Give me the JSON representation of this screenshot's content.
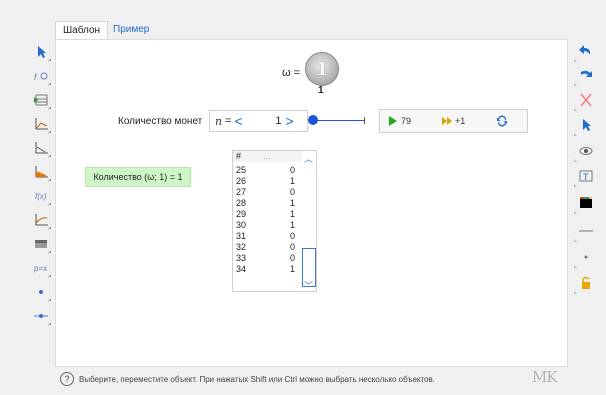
{
  "tabs": [
    {
      "label": "Шаблон"
    },
    {
      "label": "Пример"
    }
  ],
  "canvas": {
    "omega_label": "ω =",
    "coin_glyph": "1",
    "coin_value": "1",
    "count_label": "Количество монет",
    "stepper": {
      "var": "n",
      "eq": "=",
      "left": "<",
      "value": "1",
      "right": ">"
    },
    "slider": {
      "value": 1,
      "min": 1,
      "max": 10
    },
    "buttons": {
      "play_label": "79",
      "step_label": "+1"
    },
    "badge": "Количество (ω; 1) = 1",
    "table": {
      "headers": [
        "#",
        "..."
      ],
      "rows": [
        {
          "n": "25",
          "v": "0"
        },
        {
          "n": "26",
          "v": "1"
        },
        {
          "n": "27",
          "v": "0"
        },
        {
          "n": "28",
          "v": "1"
        },
        {
          "n": "29",
          "v": "1"
        },
        {
          "n": "30",
          "v": "1"
        },
        {
          "n": "31",
          "v": "0"
        },
        {
          "n": "32",
          "v": "0"
        },
        {
          "n": "33",
          "v": "0"
        },
        {
          "n": "34",
          "v": "1"
        }
      ]
    }
  },
  "status": {
    "text": "Выберите, переместите объект. При нажатых Shift или Ctrl можно выбрать несколько объектов.",
    "logo": "MK"
  },
  "left_tools": [
    "arrow-icon",
    "function-icon",
    "grid-icon",
    "axes-icon",
    "axes-icon",
    "area-icon",
    "function-f-icon",
    "curve-icon",
    "rectangle-icon",
    "p-icon",
    "point-icon",
    "segment-icon"
  ],
  "right_tools": [
    "undo-icon",
    "redo-icon",
    "delete-icon",
    "select-icon",
    "eye-icon",
    "text-icon",
    "color-icon",
    "line-icon",
    "dot-icon",
    "lock-icon"
  ],
  "colors": {
    "accent": "#1f6bd1",
    "badge_bg": "#cdf5c5",
    "play": "#22aa22"
  }
}
